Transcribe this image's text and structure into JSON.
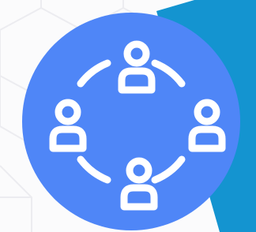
{
  "graphic": {
    "subject": "network-of-people",
    "icon": "four-user-network-icon",
    "colors": {
      "page_background": "#fbfbfc",
      "hex_pattern_line": "#ececf0",
      "backdrop_shape": "#1494d0",
      "circle_fill": "#4f86f7",
      "icon_stroke": "#ffffff"
    }
  }
}
